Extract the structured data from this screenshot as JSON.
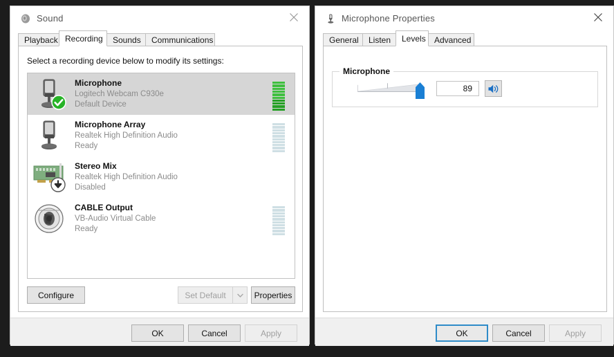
{
  "sound_window": {
    "title": "Sound",
    "title_icon": "speaker-icon",
    "close_label": "×",
    "tabs": [
      {
        "label": "Playback",
        "active": false
      },
      {
        "label": "Recording",
        "active": true
      },
      {
        "label": "Sounds",
        "active": false
      },
      {
        "label": "Communications",
        "active": false
      }
    ],
    "hint": "Select a recording device below to modify its settings:",
    "devices": [
      {
        "name": "Microphone",
        "description": "Logitech Webcam C930e",
        "state": "Default Device",
        "icon": "microphone-icon",
        "badge": "check-badge",
        "selected": true,
        "meter": "active",
        "meter_level": 10
      },
      {
        "name": "Microphone Array",
        "description": "Realtek High Definition Audio",
        "state": "Ready",
        "icon": "microphone-icon",
        "badge": "",
        "selected": false,
        "meter": "idle",
        "meter_level": 0
      },
      {
        "name": "Stereo Mix",
        "description": "Realtek High Definition Audio",
        "state": "Disabled",
        "icon": "sound-card-icon",
        "badge": "down-arrow-badge",
        "selected": false,
        "meter": "none",
        "meter_level": 0
      },
      {
        "name": "CABLE Output",
        "description": "VB-Audio Virtual Cable",
        "state": "Ready",
        "icon": "speaker-cone-icon",
        "badge": "",
        "selected": false,
        "meter": "idle",
        "meter_level": 0
      }
    ],
    "buttons": {
      "configure": "Configure",
      "set_default": "Set Default",
      "set_default_arrow": "chevron-down-icon",
      "properties": "Properties",
      "ok": "OK",
      "cancel": "Cancel",
      "apply": "Apply"
    }
  },
  "mic_properties_window": {
    "title": "Microphone Properties",
    "title_icon": "microphone-icon",
    "close_label": "×",
    "tabs": [
      {
        "label": "General",
        "active": false
      },
      {
        "label": "Listen",
        "active": false
      },
      {
        "label": "Levels",
        "active": true
      },
      {
        "label": "Advanced",
        "active": false
      }
    ],
    "level_group": {
      "title": "Microphone",
      "value": "89",
      "value_number": 89,
      "min": 0,
      "max": 100,
      "mute_icon": "speaker-on-icon"
    },
    "buttons": {
      "ok": "OK",
      "cancel": "Cancel",
      "apply": "Apply"
    }
  },
  "colors": {
    "accent": "#2e8bc8",
    "meter_green": "#3fbf3f",
    "meter_idle": "#cfdfe4",
    "slider_blue": "#1a7fd4",
    "selected_row": "#d6d6d6"
  }
}
